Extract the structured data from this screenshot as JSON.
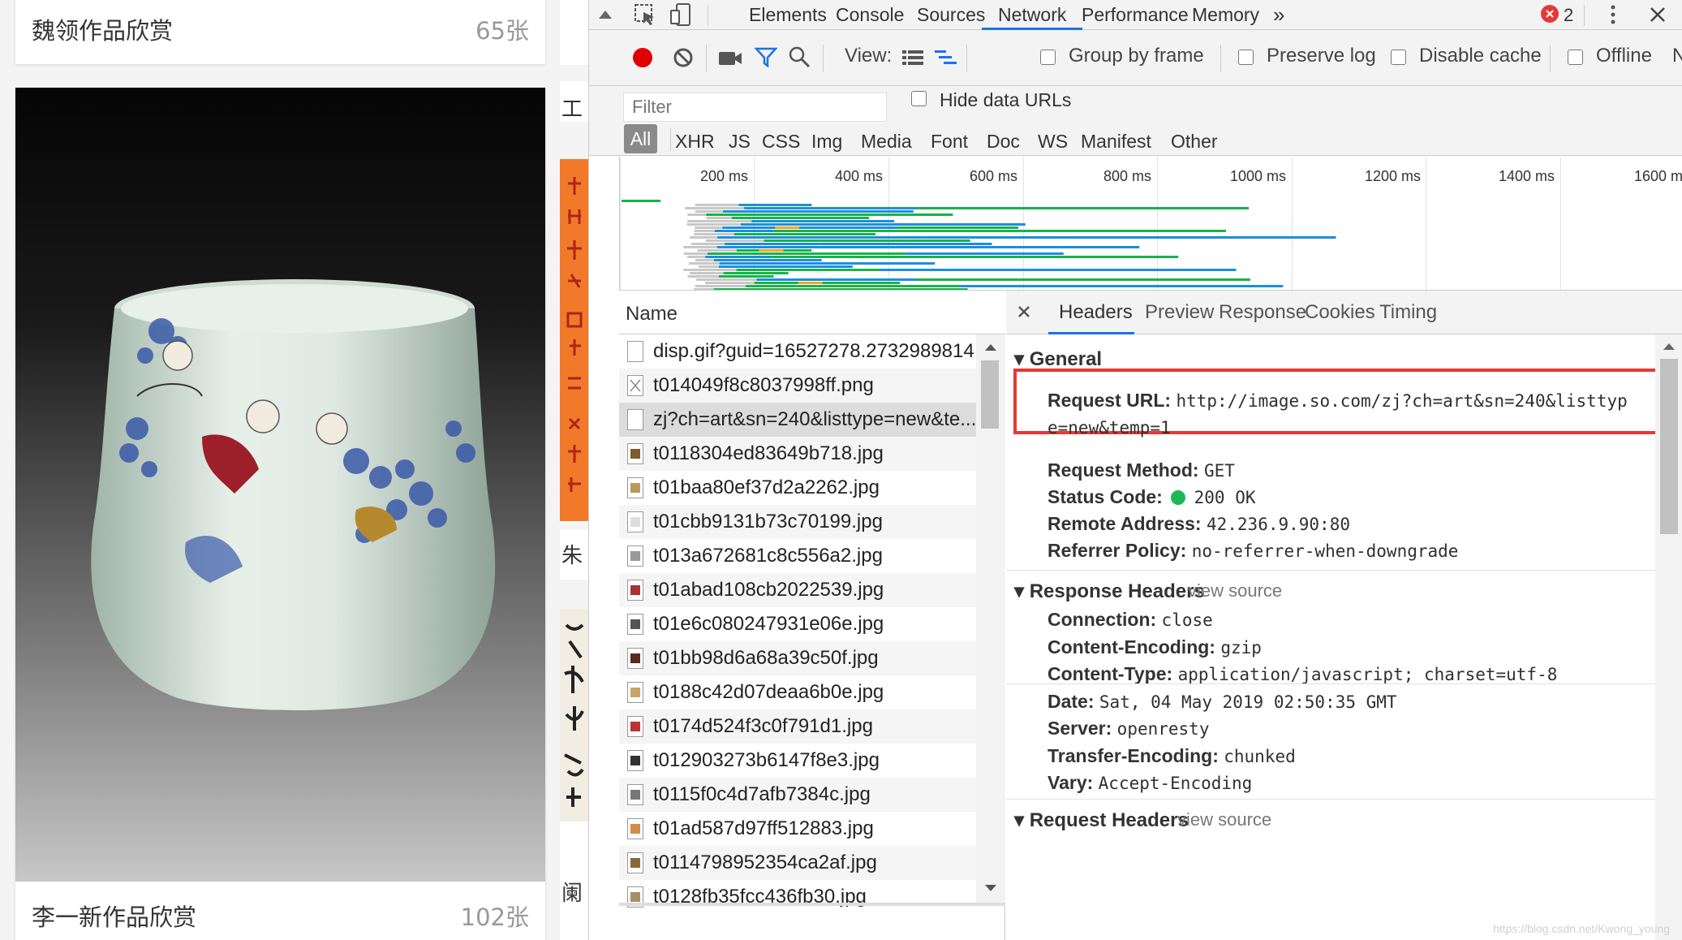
{
  "webpage": {
    "cards": [
      {
        "title": "魏领作品欣赏",
        "count": "65张"
      },
      {
        "title": "李一新作品欣赏",
        "count": "102张"
      }
    ],
    "side_chars": [
      "工",
      "朱",
      "阑"
    ]
  },
  "devtools": {
    "main_tabs": [
      "Elements",
      "Console",
      "Sources",
      "Network",
      "Performance",
      "Memory"
    ],
    "active_tab": "Network",
    "more_tabs_glyph": "»",
    "error_count": "2",
    "toolbar": {
      "view_label": "View:",
      "group_by_frame": "Group by frame",
      "preserve_log": "Preserve log",
      "disable_cache": "Disable cache",
      "offline": "Offline",
      "overflow_char": "N"
    },
    "filter": {
      "placeholder": "Filter",
      "hide_data_urls": "Hide data URLs",
      "types": [
        "All",
        "XHR",
        "JS",
        "CSS",
        "Img",
        "Media",
        "Font",
        "Doc",
        "WS",
        "Manifest",
        "Other"
      ]
    },
    "timeline_ticks": [
      "200 ms",
      "400 ms",
      "600 ms",
      "800 ms",
      "1000 ms",
      "1200 ms",
      "1400 ms",
      "1600 ms"
    ],
    "name_header": "Name",
    "requests": [
      "disp.gif?guid=16527278.2732989814",
      "t014049f8c8037998ff.png",
      "zj?ch=art&sn=240&listtype=new&te...",
      "t0118304ed83649b718.jpg",
      "t01baa80ef37d2a2262.jpg",
      "t01cbb9131b73c70199.jpg",
      "t013a672681c8c556a2.jpg",
      "t01abad108cb2022539.jpg",
      "t01e6c080247931e06e.jpg",
      "t01bb98d6a68a39c50f.jpg",
      "t0188c42d07deaa6b0e.jpg",
      "t0174d524f3c0f791d1.jpg",
      "t012903273b6147f8e3.jpg",
      "t0115f0c4d7afb7384c.jpg",
      "t01ad587d97ff512883.jpg",
      "t0114798952354ca2af.jpg",
      "t0128fb35fcc436fb30.jpg"
    ],
    "detail_tabs": [
      "Headers",
      "Preview",
      "Response",
      "Cookies",
      "Timing"
    ],
    "active_detail_tab": "Headers",
    "general": {
      "title": "General",
      "request_url_key": "Request URL:",
      "request_url_line1": "http://image.so.com/zj?ch=art&sn=240&listtyp",
      "request_url_line2": "e=new&temp=1",
      "request_method_key": "Request Method:",
      "request_method": "GET",
      "status_code_key": "Status Code:",
      "status_code": "200 OK",
      "remote_address_key": "Remote Address:",
      "remote_address": "42.236.9.90:80",
      "referrer_policy_key": "Referrer Policy:",
      "referrer_policy": "no-referrer-when-downgrade"
    },
    "response_headers": {
      "title": "Response Headers",
      "view_source": "view source",
      "items": [
        {
          "k": "Connection:",
          "v": "close"
        },
        {
          "k": "Content-Encoding:",
          "v": "gzip"
        },
        {
          "k": "Content-Type:",
          "v": "application/javascript; charset=utf-8"
        },
        {
          "k": "Date:",
          "v": "Sat, 04 May 2019 02:50:35 GMT"
        },
        {
          "k": "Server:",
          "v": "openresty"
        },
        {
          "k": "Transfer-Encoding:",
          "v": "chunked"
        },
        {
          "k": "Vary:",
          "v": "Accept-Encoding"
        }
      ]
    },
    "request_headers": {
      "title": "Request Headers",
      "view_source": "view source"
    },
    "status_color": "#1db954",
    "highlight_color": "#e53935",
    "accent_color": "#1a73e8"
  },
  "watermark": "https://blog.csdn.net/Kwong_young"
}
